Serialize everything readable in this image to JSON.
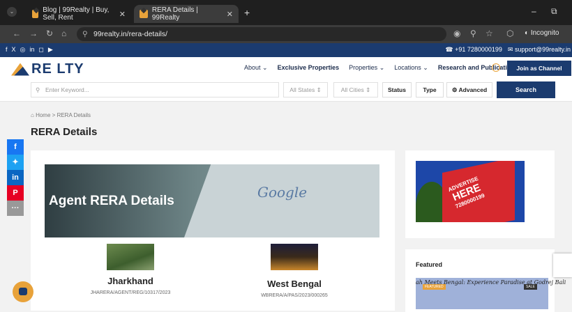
{
  "browser": {
    "tabs": [
      {
        "title": "Blog | 99Realty | Buy, Sell, Rent",
        "close": "✕"
      },
      {
        "title": "RERA Details | 99Realty",
        "close": "✕"
      }
    ],
    "new_tab": "+",
    "minimize": "–",
    "restore": "⧉",
    "url": "99realty.in/rera-details/",
    "incognito_label": "Incognito"
  },
  "topstrip": {
    "phone": "+91 7280000199",
    "email": "support@99realty.in"
  },
  "header": {
    "logo_text": "RE LTY",
    "menu": [
      {
        "label": "About",
        "caret": "⌄"
      },
      {
        "label": "Exclusive Properties",
        "caret": ""
      },
      {
        "label": "Properties",
        "caret": "⌄"
      },
      {
        "label": "Locations",
        "caret": "⌄"
      },
      {
        "label": "Research and Publications",
        "caret": "⌄"
      }
    ],
    "join_label": "Join as Channel Partner"
  },
  "search": {
    "keyword_placeholder": "Enter Keyword...",
    "states_label": "All States",
    "cities_label": "All Cities",
    "status_label": "Status",
    "type_label": "Type",
    "advanced_label": "Advanced",
    "search_button": "Search"
  },
  "breadcrumb": {
    "home": "Home",
    "sep": ">",
    "current": "RERA Details"
  },
  "page_title": "RERA Details",
  "banner": {
    "title": "Agent RERA Details",
    "logo_text": "Google"
  },
  "states": [
    {
      "name": "Jharkhand",
      "reg": "JHARERA/AGENT/REG/10317/2023"
    },
    {
      "name": "West Bengal",
      "reg": "WBRERA/A/PAS/2023/000265"
    }
  ],
  "ad": {
    "line1": "ADVERTISE",
    "line2": "HERE",
    "line3": "7280000199"
  },
  "featured": {
    "heading": "Featured",
    "post_title": "ah Meets Bengal: Experience Paradise at Godrej Bali",
    "badge1": "FEATURED",
    "badge2": "SALE"
  },
  "colors": {
    "brand_navy": "#1b3b6f",
    "brand_orange": "#e8a23a"
  }
}
